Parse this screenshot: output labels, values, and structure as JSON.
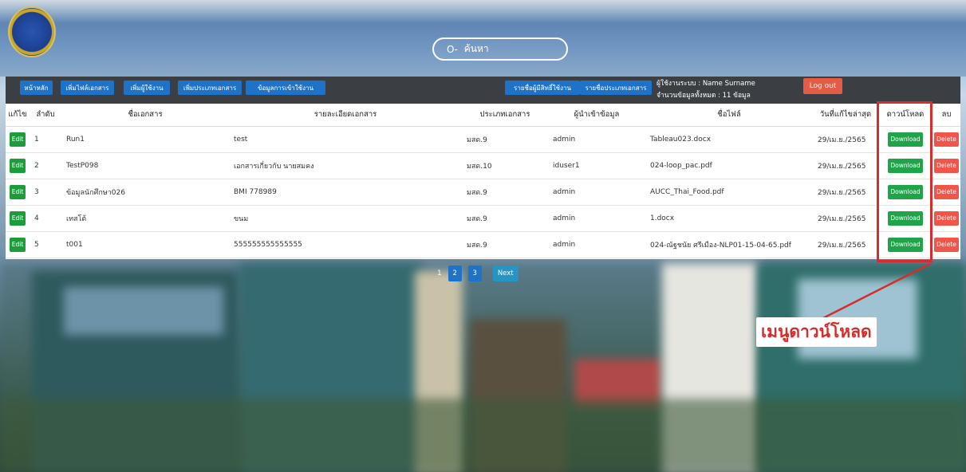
{
  "search": {
    "label": "ค้นหา"
  },
  "nav": {
    "left_buttons": [
      "หน้าหลัก",
      "เพิ่มไฟล์เอกสาร",
      "เพิ่มผู้ใช้งาน",
      "เพิ่มประเภทเอกสาร",
      "ข้อมูลการเข้าใช้งาน"
    ],
    "right_buttons": [
      "รายชื่อผู้มีสิทธิ์ใช้งาน",
      "รายชื่อประเภทเอกสาร"
    ],
    "user_line": "ผู้ใช้งานระบบ : Name Surname",
    "count_line": "จำนวนข้อมูลทั้งหมด : 11 ข้อมูล",
    "logout_label": "Log out"
  },
  "table": {
    "headers": [
      "แก้ไข",
      "ลำดับ",
      "ชื่อเอกสาร",
      "รายละเอียดเอกสาร",
      "ประเภทเอกสาร",
      "ผู้นำเข้าข้อมูล",
      "ชื่อไฟล์",
      "วันที่แก้ไขล่าสุด",
      "ดาวน์โหลด",
      "ลบ"
    ],
    "edit_label": "Edit",
    "download_label": "Download",
    "delete_label": "Delete",
    "rows": [
      {
        "no": "1",
        "name": "Run1",
        "detail": "test",
        "type": "มสด.9",
        "importer": "admin",
        "file": "Tableau023.docx",
        "date": "29/เม.ย./2565"
      },
      {
        "no": "2",
        "name": "TestP098",
        "detail": "เอกสารเกี่ยวกับ นายสมคง",
        "type": "มสด.10",
        "importer": "iduser1",
        "file": "024-loop_pac.pdf",
        "date": "29/เม.ย./2565"
      },
      {
        "no": "3",
        "name": "ข้อมูลนักศึกษา026",
        "detail": "BMI 778989",
        "type": "มสด.9",
        "importer": "admin",
        "file": "AUCC_Thai_Food.pdf",
        "date": "29/เม.ย./2565"
      },
      {
        "no": "4",
        "name": "เทสโต้",
        "detail": "ขนม",
        "type": "มสด.9",
        "importer": "admin",
        "file": "1.docx",
        "date": "29/เม.ย./2565"
      },
      {
        "no": "5",
        "name": "t001",
        "detail": "555555555555555",
        "type": "มสด.9",
        "importer": "admin",
        "file": "024-ณัฐชนัย ศรีเมือง-NLP01-15-04-65.pdf",
        "date": "29/เม.ย./2565"
      }
    ]
  },
  "pager": {
    "current": "1",
    "pages": [
      "2",
      "3"
    ],
    "next_label": "Next"
  },
  "annotation": {
    "label": "เมนูดาวน์โหลด",
    "color": "#d62c2c"
  },
  "colors": {
    "navbar": "#3b3f44",
    "nav_button": "#1e73c8",
    "download": "#20a44a",
    "delete": "#f0554a",
    "logout": "#e65b44"
  }
}
